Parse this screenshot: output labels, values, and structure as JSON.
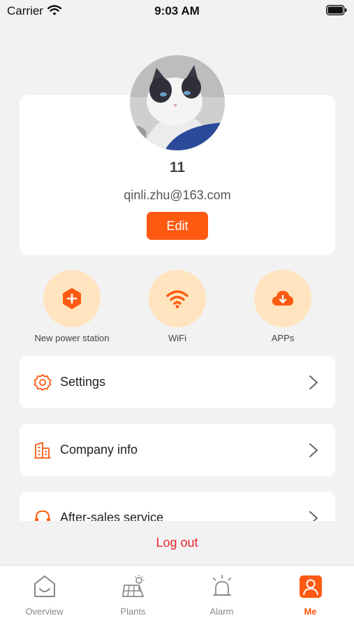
{
  "status_bar": {
    "carrier": "Carrier",
    "time": "9:03 AM"
  },
  "profile": {
    "name": "11",
    "email": "qinli.zhu@163.com",
    "edit_label": "Edit"
  },
  "quick_actions": [
    {
      "label": "New power station",
      "icon": "add-station-icon"
    },
    {
      "label": "WiFi",
      "icon": "wifi-icon"
    },
    {
      "label": "APPs",
      "icon": "cloud-download-icon"
    }
  ],
  "menu": [
    {
      "label": "Settings",
      "icon": "settings-gear-icon"
    },
    {
      "label": "Company info",
      "icon": "building-icon"
    },
    {
      "label": "After-sales service",
      "icon": "headset-icon"
    }
  ],
  "logout_label": "Log out",
  "tabs": [
    {
      "label": "Overview",
      "icon": "home-icon",
      "active": false
    },
    {
      "label": "Plants",
      "icon": "solar-panel-icon",
      "active": false
    },
    {
      "label": "Alarm",
      "icon": "alarm-siren-icon",
      "active": false
    },
    {
      "label": "Me",
      "icon": "user-icon",
      "active": true
    }
  ],
  "colors": {
    "accent": "#fe5a12",
    "soft_accent": "#ffe4bf",
    "logout": "#e8242e",
    "background": "#f2f2f2"
  }
}
